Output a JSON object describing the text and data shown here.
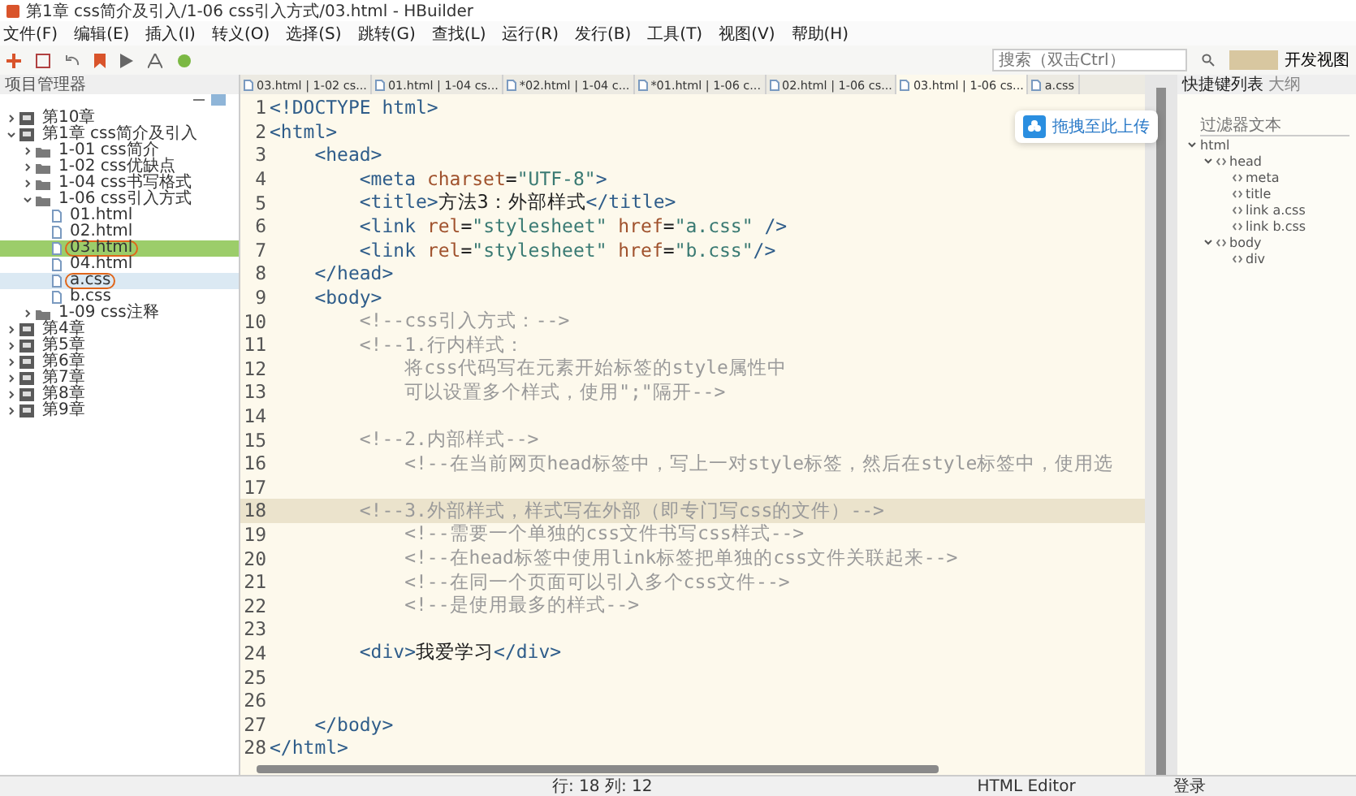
{
  "window": {
    "title": "第1章 css简介及引入/1-06 css引入方式/03.html - HBuilder"
  },
  "menu": [
    "文件(F)",
    "编辑(E)",
    "插入(I)",
    "转义(O)",
    "选择(S)",
    "跳转(G)",
    "查找(L)",
    "运行(R)",
    "发行(B)",
    "工具(T)",
    "视图(V)",
    "帮助(H)"
  ],
  "search": {
    "placeholder": "搜索（双击Ctrl）"
  },
  "view_button": "开发视图",
  "project_panel": {
    "title": "项目管理器",
    "tree": [
      {
        "label": "第10章",
        "kind": "project",
        "expanded": false,
        "selected": false,
        "annotated": false
      },
      {
        "label": "第1章 css简介及引入",
        "kind": "project",
        "expanded": true,
        "selected": false,
        "annotated": false,
        "children": [
          {
            "label": "1-01 css简介",
            "kind": "folder",
            "expanded": false,
            "selected": false,
            "annotated": false
          },
          {
            "label": "1-02 css优缺点",
            "kind": "folder",
            "expanded": false,
            "selected": false,
            "annotated": false
          },
          {
            "label": "1-04 css书写格式",
            "kind": "folder",
            "expanded": false,
            "selected": false,
            "annotated": false
          },
          {
            "label": "1-06 css引入方式",
            "kind": "folder",
            "expanded": true,
            "selected": false,
            "annotated": false,
            "children": [
              {
                "label": "01.html",
                "kind": "file",
                "selected": false,
                "annotated": false
              },
              {
                "label": "02.html",
                "kind": "file",
                "selected": false,
                "annotated": false
              },
              {
                "label": "03.html",
                "kind": "file",
                "selected": true,
                "annotated": true
              },
              {
                "label": "04.html",
                "kind": "file",
                "selected": false,
                "annotated": false
              },
              {
                "label": "a.css",
                "kind": "file",
                "selected": false,
                "hovered": true,
                "annotated": true
              },
              {
                "label": "b.css",
                "kind": "file",
                "selected": false,
                "annotated": false
              }
            ]
          },
          {
            "label": "1-09 css注释",
            "kind": "folder",
            "expanded": false,
            "selected": false,
            "annotated": false
          }
        ]
      },
      {
        "label": "第4章",
        "kind": "project",
        "expanded": false,
        "selected": false,
        "annotated": false
      },
      {
        "label": "第5章",
        "kind": "project",
        "expanded": false,
        "selected": false,
        "annotated": false
      },
      {
        "label": "第6章",
        "kind": "project",
        "expanded": false,
        "selected": false,
        "annotated": false
      },
      {
        "label": "第7章",
        "kind": "project",
        "expanded": false,
        "selected": false,
        "annotated": false
      },
      {
        "label": "第8章",
        "kind": "project",
        "expanded": false,
        "selected": false,
        "annotated": false
      },
      {
        "label": "第9章",
        "kind": "project",
        "expanded": false,
        "selected": false,
        "annotated": false
      }
    ]
  },
  "tabs": [
    {
      "label": "03.html | 1-02 cs...",
      "selected": false
    },
    {
      "label": "01.html | 1-04 cs...",
      "selected": false
    },
    {
      "label": "*02.html | 1-04 c...",
      "selected": false
    },
    {
      "label": "*01.html | 1-06 c...",
      "selected": false
    },
    {
      "label": "02.html | 1-06 cs...",
      "selected": false
    },
    {
      "label": "03.html | 1-06 cs...",
      "selected": true
    },
    {
      "label": "a.css",
      "selected": false
    }
  ],
  "editor": {
    "lines": [
      {
        "number": "1",
        "current": false,
        "tokens": [
          {
            "kind": "tag",
            "text": "<!DOCTYPE html>"
          }
        ]
      },
      {
        "number": "2",
        "current": false,
        "tokens": [
          {
            "kind": "tag",
            "text": "<html>"
          }
        ]
      },
      {
        "number": "3",
        "current": false,
        "tokens": [
          {
            "kind": "tag",
            "text": "    <head>"
          }
        ]
      },
      {
        "number": "4",
        "current": false,
        "tokens": [
          {
            "kind": "tag",
            "text": "        <meta "
          },
          {
            "kind": "attr",
            "text": "charset"
          },
          {
            "kind": "plain",
            "text": "="
          },
          {
            "kind": "string",
            "text": "\"UTF-8\""
          },
          {
            "kind": "tag",
            "text": ">"
          }
        ]
      },
      {
        "number": "5",
        "current": false,
        "tokens": [
          {
            "kind": "tag",
            "text": "        <title>"
          },
          {
            "kind": "plain",
            "text": "方法3：外部样式"
          },
          {
            "kind": "tag",
            "text": "</title>"
          }
        ]
      },
      {
        "number": "6",
        "current": false,
        "tokens": [
          {
            "kind": "tag",
            "text": "        <link "
          },
          {
            "kind": "attr",
            "text": "rel"
          },
          {
            "kind": "plain",
            "text": "="
          },
          {
            "kind": "string",
            "text": "\"stylesheet\" "
          },
          {
            "kind": "attr",
            "text": "href"
          },
          {
            "kind": "plain",
            "text": "="
          },
          {
            "kind": "string",
            "text": "\"a.css\" "
          },
          {
            "kind": "tag",
            "text": "/>"
          }
        ]
      },
      {
        "number": "7",
        "current": false,
        "tokens": [
          {
            "kind": "tag",
            "text": "        <link "
          },
          {
            "kind": "attr",
            "text": "rel"
          },
          {
            "kind": "plain",
            "text": "="
          },
          {
            "kind": "string",
            "text": "\"stylesheet\" "
          },
          {
            "kind": "attr",
            "text": "href"
          },
          {
            "kind": "plain",
            "text": "="
          },
          {
            "kind": "string",
            "text": "\"b.css\""
          },
          {
            "kind": "tag",
            "text": "/>"
          }
        ]
      },
      {
        "number": "8",
        "current": false,
        "tokens": [
          {
            "kind": "tag",
            "text": "    </head>"
          }
        ]
      },
      {
        "number": "9",
        "current": false,
        "tokens": [
          {
            "kind": "tag",
            "text": "    <body>"
          }
        ]
      },
      {
        "number": "10",
        "current": false,
        "tokens": [
          {
            "kind": "comment",
            "text": "        <!--css引入方式：-->"
          }
        ]
      },
      {
        "number": "11",
        "current": false,
        "tokens": [
          {
            "kind": "comment",
            "text": "        <!--1.行内样式："
          }
        ]
      },
      {
        "number": "12",
        "current": false,
        "tokens": [
          {
            "kind": "comment",
            "text": "            将css代码写在元素开始标签的style属性中"
          }
        ]
      },
      {
        "number": "13",
        "current": false,
        "tokens": [
          {
            "kind": "comment",
            "text": "            可以设置多个样式，使用\";\"隔开-->"
          }
        ]
      },
      {
        "number": "14",
        "current": false
      },
      {
        "number": "15",
        "current": false,
        "tokens": [
          {
            "kind": "comment",
            "text": "        <!--2.内部样式-->"
          }
        ]
      },
      {
        "number": "16",
        "current": false,
        "tokens": [
          {
            "kind": "comment",
            "text": "            <!--在当前网页head标签中，写上一对style标签，然后在style标签中，使用选"
          }
        ]
      },
      {
        "number": "17",
        "current": false
      },
      {
        "number": "18",
        "current": true,
        "tokens": [
          {
            "kind": "comment",
            "text": "        <!--3.外部样式，样式写在外部（即专门写css的文件）-->"
          }
        ]
      },
      {
        "number": "19",
        "current": false,
        "tokens": [
          {
            "kind": "comment",
            "text": "            <!--需要一个单独的css文件书写css样式-->"
          }
        ]
      },
      {
        "number": "20",
        "current": false,
        "tokens": [
          {
            "kind": "comment",
            "text": "            <!--在head标签中使用link标签把单独的css文件关联起来-->"
          }
        ]
      },
      {
        "number": "21",
        "current": false,
        "tokens": [
          {
            "kind": "comment",
            "text": "            <!--在同一个页面可以引入多个css文件-->"
          }
        ]
      },
      {
        "number": "22",
        "current": false,
        "tokens": [
          {
            "kind": "comment",
            "text": "            <!--是使用最多的样式-->"
          }
        ]
      },
      {
        "number": "23",
        "current": false
      },
      {
        "number": "24",
        "current": false,
        "tokens": [
          {
            "kind": "tag",
            "text": "        <div>"
          },
          {
            "kind": "plain",
            "text": "我爱学习"
          },
          {
            "kind": "tag",
            "text": "</div>"
          }
        ]
      },
      {
        "number": "25",
        "current": false
      },
      {
        "number": "26",
        "current": false
      },
      {
        "number": "27",
        "current": false,
        "tokens": [
          {
            "kind": "tag",
            "text": "    </body>"
          }
        ]
      },
      {
        "number": "28",
        "current": false,
        "tokens": [
          {
            "kind": "tag",
            "text": "</html>"
          }
        ]
      }
    ]
  },
  "upload_popup": "拖拽至此上传",
  "outline_panel": {
    "tabs": [
      {
        "label": "快捷键列表",
        "selected": true
      },
      {
        "label": "大纲",
        "selected": false
      }
    ],
    "filter": {
      "placeholder": "过滤器文本"
    },
    "tree": [
      {
        "label": "html",
        "expanded": true,
        "children": [
          {
            "label": "head",
            "expanded": true,
            "children": [
              {
                "label": "meta"
              },
              {
                "label": "title"
              },
              {
                "label": "link a.css"
              },
              {
                "label": "link b.css"
              }
            ]
          },
          {
            "label": "body",
            "expanded": true,
            "children": [
              {
                "label": "div"
              }
            ]
          }
        ]
      }
    ]
  },
  "status_bar": {
    "position": "行: 18 列: 12",
    "mode": "HTML Editor",
    "login": "登录"
  }
}
